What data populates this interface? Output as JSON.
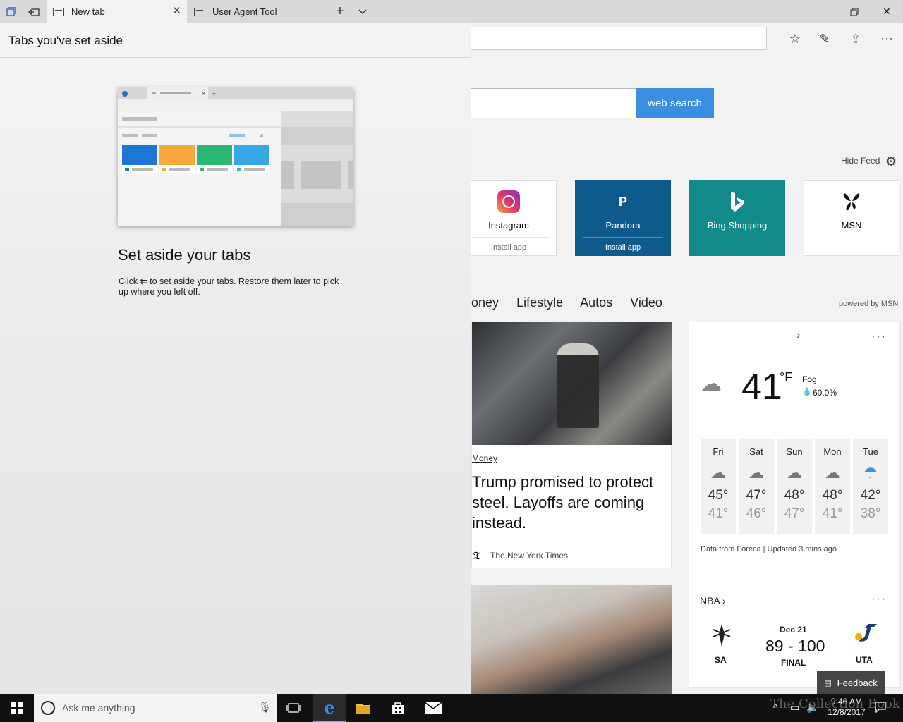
{
  "tabbar": {
    "tabs": [
      {
        "label": "New tab",
        "active": true
      },
      {
        "label": "User Agent Tool",
        "active": false
      }
    ],
    "icons": [
      "tabs-aside-icon",
      "set-aside-tabs-icon",
      "new-tab-plus-icon",
      "tab-preview-chevron-icon"
    ],
    "window_controls": [
      "minimize-icon",
      "restore-icon",
      "close-icon"
    ]
  },
  "toolbar": {
    "icons": [
      "favorites-star-icon",
      "web-note-pen-icon",
      "share-icon",
      "more-dots-icon"
    ]
  },
  "search": {
    "button_label": "web search"
  },
  "feed": {
    "hide_label": "Hide Feed"
  },
  "top_sites": [
    {
      "name": "Instagram",
      "sub": "Install app",
      "bg": "#ffffff",
      "fg": "#111111"
    },
    {
      "name": "Pandora",
      "sub": "Install app",
      "bg": "#0f5a8c",
      "fg": "#ffffff",
      "logo": "P"
    },
    {
      "name": "Bing Shopping",
      "sub": "",
      "bg": "#138a8a",
      "fg": "#ffffff"
    },
    {
      "name": "MSN",
      "sub": "",
      "bg": "#ffffff",
      "fg": "#111111"
    }
  ],
  "news_nav": {
    "items": [
      "oney",
      "Lifestyle",
      "Autos",
      "Video"
    ],
    "powered_by": "powered by MSN"
  },
  "article1": {
    "category": "Money",
    "title": "Trump promised to protect steel. Layoffs are coming instead.",
    "source": "The New York Times"
  },
  "weather": {
    "temp": "41",
    "unit": "°F",
    "condition": "Fog",
    "precip": "60.0%",
    "forecast": [
      {
        "day": "Fri",
        "hi": "45°",
        "lo": "41°"
      },
      {
        "day": "Sat",
        "hi": "47°",
        "lo": "46°"
      },
      {
        "day": "Sun",
        "hi": "48°",
        "lo": "47°"
      },
      {
        "day": "Mon",
        "hi": "48°",
        "lo": "41°"
      },
      {
        "day": "Tue",
        "hi": "42°",
        "lo": "38°"
      }
    ],
    "footer": "Data from Foreca | Updated 3 mins ago"
  },
  "nba": {
    "label": "NBA",
    "date": "Dec 21",
    "score": "89 - 100",
    "status": "FINAL",
    "home": "SA",
    "away": "UTA"
  },
  "feedback": {
    "label": "Feedback"
  },
  "aside_panel": {
    "title": "Tabs you've set aside",
    "heading": "Set aside your tabs",
    "desc_before": "Click",
    "desc_after": "to set aside your tabs. Restore them later to pick up where you left off."
  },
  "taskbar": {
    "search_placeholder": "Ask me anything",
    "time": "9:46 AM",
    "date": "12/8/2017"
  },
  "watermark": {
    "text": "The Collection Book"
  },
  "colors": {
    "accent_blue": "#3b8fe0",
    "pandora": "#0f5a8c",
    "bing": "#138a8a"
  }
}
